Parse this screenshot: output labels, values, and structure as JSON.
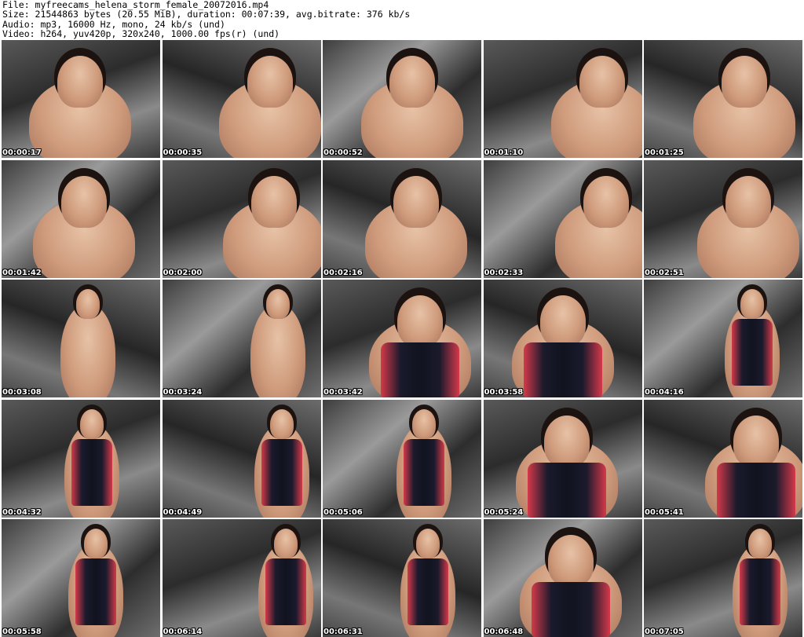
{
  "header": {
    "line1": "File: myfreecams_helena_storm_female_20072016.mp4",
    "line2": "Size: 21544863 bytes (20.55 MiB), duration: 00:07:39, avg.bitrate: 376 kb/s",
    "line3": "Audio: mp3, 16000 Hz, mono, 24 kb/s (und)",
    "line4": "Video: h264, yuv420p, 320x240, 1000.00 fps(r) (und)"
  },
  "thumbnails": [
    {
      "time": "00:00:17"
    },
    {
      "time": "00:00:35"
    },
    {
      "time": "00:00:52"
    },
    {
      "time": "00:01:10"
    },
    {
      "time": "00:01:25"
    },
    {
      "time": "00:01:42"
    },
    {
      "time": "00:02:00"
    },
    {
      "time": "00:02:16"
    },
    {
      "time": "00:02:33"
    },
    {
      "time": "00:02:51"
    },
    {
      "time": "00:03:08"
    },
    {
      "time": "00:03:24"
    },
    {
      "time": "00:03:42"
    },
    {
      "time": "00:03:58"
    },
    {
      "time": "00:04:16"
    },
    {
      "time": "00:04:32"
    },
    {
      "time": "00:04:49"
    },
    {
      "time": "00:05:06"
    },
    {
      "time": "00:05:24"
    },
    {
      "time": "00:05:41"
    },
    {
      "time": "00:05:58"
    },
    {
      "time": "00:06:14"
    },
    {
      "time": "00:06:31"
    },
    {
      "time": "00:06:48"
    },
    {
      "time": "00:07:05"
    }
  ]
}
